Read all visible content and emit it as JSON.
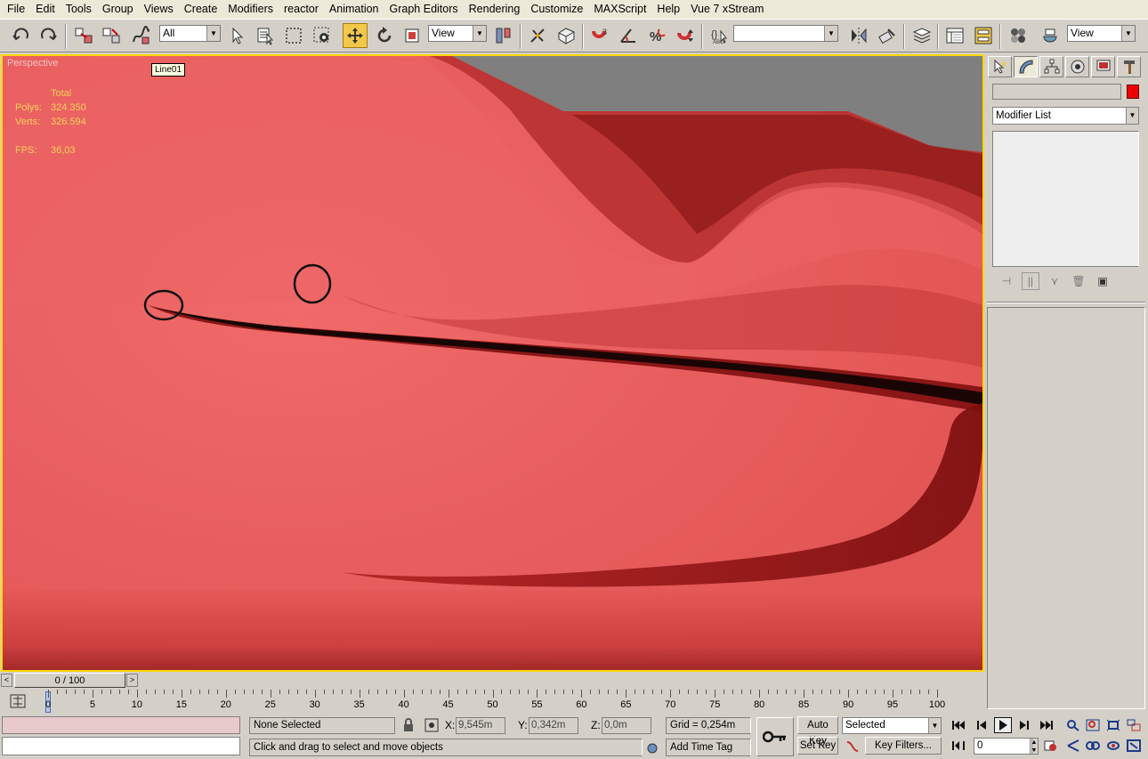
{
  "menu": [
    "File",
    "Edit",
    "Tools",
    "Group",
    "Views",
    "Create",
    "Modifiers",
    "reactor",
    "Animation",
    "Graph Editors",
    "Rendering",
    "Customize",
    "MAXScript",
    "Help",
    "Vue 7 xStream"
  ],
  "toolbar": {
    "selection_filter": "All",
    "ref_coord": "View",
    "named_selection": "",
    "render_view": "View",
    "icons": [
      "undo-icon",
      "redo-icon",
      "link-icon",
      "unlink-icon",
      "bind-space-warp-icon",
      "select-object-icon",
      "select-by-name-icon",
      "rect-selection-region-icon",
      "window-crossing-icon",
      "select-and-move-icon",
      "select-and-rotate-icon",
      "select-and-scale-icon",
      "use-pivot-center-icon",
      "select-manipulate-icon",
      "keyboard-shortcut-override-icon",
      "snaps-toggle-icon",
      "angle-snap-icon",
      "percent-snap-icon",
      "spinner-snap-icon",
      "edit-named-selection-icon",
      "mirror-icon",
      "align-icon",
      "layer-manager-icon",
      "curve-editor-icon",
      "schematic-view-icon",
      "material-editor-icon",
      "render-setup-icon"
    ]
  },
  "viewport": {
    "label": "Perspective",
    "tooltip": "Line01",
    "stats_header": "Total",
    "polys_label": "Polys:",
    "polys_value": "324.350",
    "verts_label": "Verts:",
    "verts_value": "326.594",
    "fps_label": "FPS:",
    "fps_value": "36,03"
  },
  "command_panel": {
    "tabs": [
      "create-tab",
      "modify-tab",
      "hierarchy-tab",
      "motion-tab",
      "display-tab",
      "utilities-tab"
    ],
    "object_name": "",
    "object_color": "#ee0000",
    "modifier_list": "Modifier List"
  },
  "time_slider": {
    "position": "0 / 100",
    "prev_label": "<",
    "next_label": ">"
  },
  "track_bar": {
    "ticks": [
      0,
      5,
      10,
      15,
      20,
      25,
      30,
      35,
      40,
      45,
      50,
      55,
      60,
      65,
      70,
      75,
      80,
      85,
      90,
      95,
      100
    ]
  },
  "status": {
    "selection": "None Selected",
    "prompt": "Click and drag to select and move objects",
    "x_label": "X:",
    "x_value": "9,545m",
    "y_label": "Y:",
    "y_value": "0,342m",
    "z_label": "Z:",
    "z_value": "0,0m",
    "grid": "Grid = 0,254m",
    "add_time_tag": "Add Time Tag",
    "auto_key": "Auto Key",
    "set_key": "Set Key",
    "key_mode": "Selected",
    "key_filters": "Key Filters...",
    "current_frame": "0"
  },
  "colors": {
    "viewport_border": "#ffd700",
    "stats_text": "#f3d15a",
    "model_base": "#e85e5e",
    "background_gray": "#7f7f7f"
  }
}
